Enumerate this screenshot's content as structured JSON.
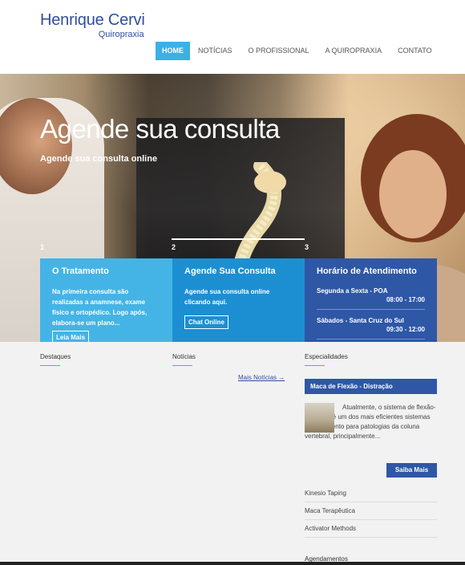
{
  "logo": {
    "name": "Henrique Cervi",
    "sub": "Quiropraxia"
  },
  "nav": [
    "HOME",
    "NOTÍCIAS",
    "O PROFISSIONAL",
    "A QUIROPRAXIA",
    "CONTATO"
  ],
  "hero": {
    "title": "Agende sua consulta",
    "subtitle": "Agende sua consulta online",
    "slides": [
      "1",
      "2",
      "3"
    ]
  },
  "boxes": {
    "tratamento": {
      "title": "O Tratamento",
      "text": "Na primeira consulta são realizadas a anamnese, exame físico e ortopédico. Logo após, elabora-se um plano...",
      "button": "Leia Mais"
    },
    "consulta": {
      "title": "Agende Sua Consulta",
      "text": "Agende sua consulta online clicando aqui.",
      "button": "Chat Online"
    },
    "horario": {
      "title": "Horário de Atendimento",
      "rows": [
        {
          "days": "Segunda a Sexta - POA",
          "time": "08:00 - 17:00"
        },
        {
          "days": "Sábados - Santa Cruz do Sul",
          "time": "09:30 - 12:00"
        }
      ]
    }
  },
  "columns": {
    "destaques": "Destaques",
    "noticias": "Notícias",
    "mais_noticias": "Mais Notícias →",
    "especialidades": "Especialidades"
  },
  "especialidades": {
    "featured_title": "Maca de Flexão - Distração",
    "featured_text": "Atualmente, o sistema de flexão-distração é um dos mais eficientes sistemas de tratamento para patologias da coluna vertebral, principalmente...",
    "button": "Saiba Mais",
    "items": [
      "Kinesio Taping",
      "Maca Terapêutica",
      "Activator Methods"
    ],
    "next_heading": "Agendamentos"
  },
  "colors": {
    "accent": "#3ab1e6",
    "brand": "#2f4fa0",
    "box1": "#44b4e6",
    "box2": "#1c8fd3",
    "box3": "#2e57a6"
  }
}
